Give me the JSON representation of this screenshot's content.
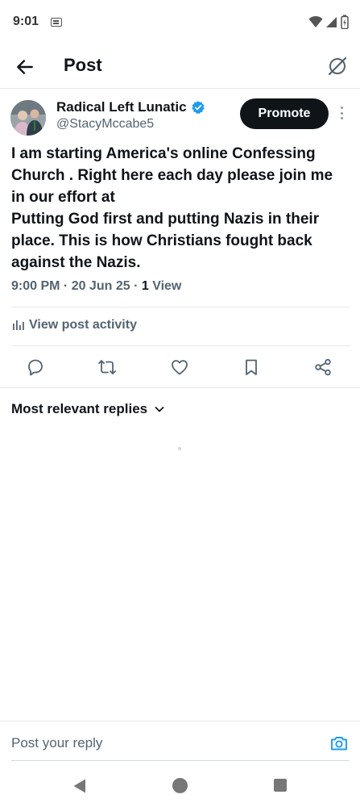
{
  "status_bar": {
    "time": "9:01"
  },
  "header": {
    "title": "Post"
  },
  "post": {
    "author": {
      "display_name": "Radical Left Lunatic",
      "handle": "@StacyMccabe5",
      "verified": true
    },
    "promote_label": "Promote",
    "text": "I am starting America's online Confessing Church . Right here each day please join me in our effort at\nPutting God first and putting Nazis in their place. This is how Christians fought back against the Nazis.",
    "timestamp": "9:00 PM · 20 Jun 25 · ",
    "view_count": "1",
    "view_label": " View",
    "activity_label": "View post activity"
  },
  "replies": {
    "sort_label": "Most relevant replies"
  },
  "reply_bar": {
    "placeholder": "Post your reply"
  },
  "icons": {
    "back": "arrow-left-icon",
    "grok": "grok-icon",
    "verified": "verified-badge-icon",
    "more": "more-vertical-icon",
    "activity": "bar-chart-icon",
    "reply": "reply-icon",
    "repost": "repost-icon",
    "like": "heart-icon",
    "bookmark": "bookmark-icon",
    "share": "share-icon",
    "chevron": "chevron-down-icon",
    "camera": "camera-icon"
  },
  "colors": {
    "text": "#0f1419",
    "secondary": "#536471",
    "accent": "#1d9bf0",
    "divider": "#e7e9ea"
  }
}
